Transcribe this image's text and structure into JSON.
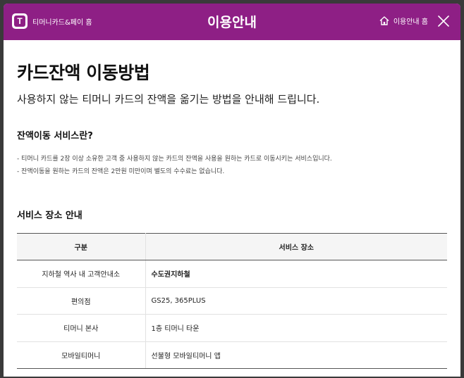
{
  "header": {
    "brand": "티머니카드&페이 홈",
    "logo_letter": "T",
    "title": "이용안내",
    "home_label": "이용안내 홈",
    "accent_color": "#8e1f85"
  },
  "main": {
    "title": "카드잔액 이동방법",
    "subtitle": "사용하지 않는 티머니 카드의 잔액을 옮기는 방법을 안내해 드립니다.",
    "section1": {
      "title": "잔액이동 서비스란?",
      "lines": [
        "- 티머니 카드를 2장 이상 소유한 고객 중 사용하지 않는 카드의 잔액을 사용을 원하는 카드로 이동시키는 서비스입니다.",
        "- 잔액이동을 원하는 카드의 잔액은 2만원 미만이며 별도의 수수료는 없습니다."
      ]
    },
    "section2": {
      "title": "서비스 장소 안내",
      "table": {
        "headers": [
          "구분",
          "서비스 장소"
        ],
        "rows": [
          {
            "category": "지하철 역사 내 고객안내소",
            "place": "수도권지하철"
          },
          {
            "category": "편의점",
            "place": "GS25, 365PLUS"
          },
          {
            "category": "티머니 본사",
            "place": "1층 티머니 타운"
          },
          {
            "category": "모바일티머니",
            "place": "선불형 모바일티머니 앱"
          }
        ]
      }
    }
  },
  "icons": {
    "home": "home-icon",
    "close": "close-icon"
  }
}
